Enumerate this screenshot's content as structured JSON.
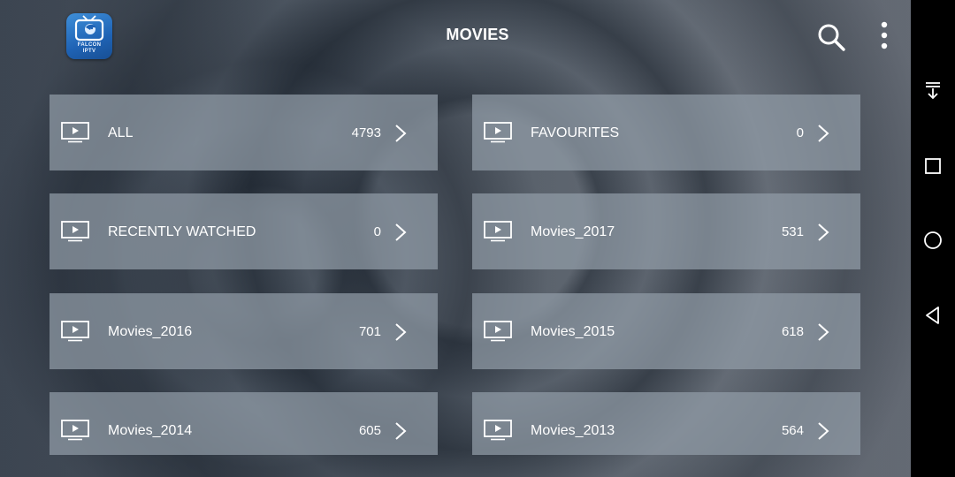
{
  "header": {
    "logo_line1": "FALCON",
    "logo_line2": "IPTV",
    "title": "MOVIES",
    "search_icon": "search-icon",
    "more_icon": "more-vertical-icon"
  },
  "categories": [
    {
      "label": "ALL",
      "count": "4793"
    },
    {
      "label": "FAVOURITES",
      "count": "0"
    },
    {
      "label": "RECENTLY WATCHED",
      "count": "0"
    },
    {
      "label": "Movies_2017",
      "count": "531"
    },
    {
      "label": "Movies_2016",
      "count": "701"
    },
    {
      "label": "Movies_2015",
      "count": "618"
    },
    {
      "label": "Movies_2014",
      "count": "605"
    },
    {
      "label": "Movies_2013",
      "count": "564"
    }
  ],
  "nav_bar": {
    "buttons": [
      "notification-pull-down-icon",
      "recents-square-icon",
      "home-circle-icon",
      "back-triangle-icon"
    ]
  },
  "colors": {
    "tile": "#919ca7",
    "text": "#ffffff",
    "logo": "#2a72c4",
    "nav_bar": "#000000"
  }
}
